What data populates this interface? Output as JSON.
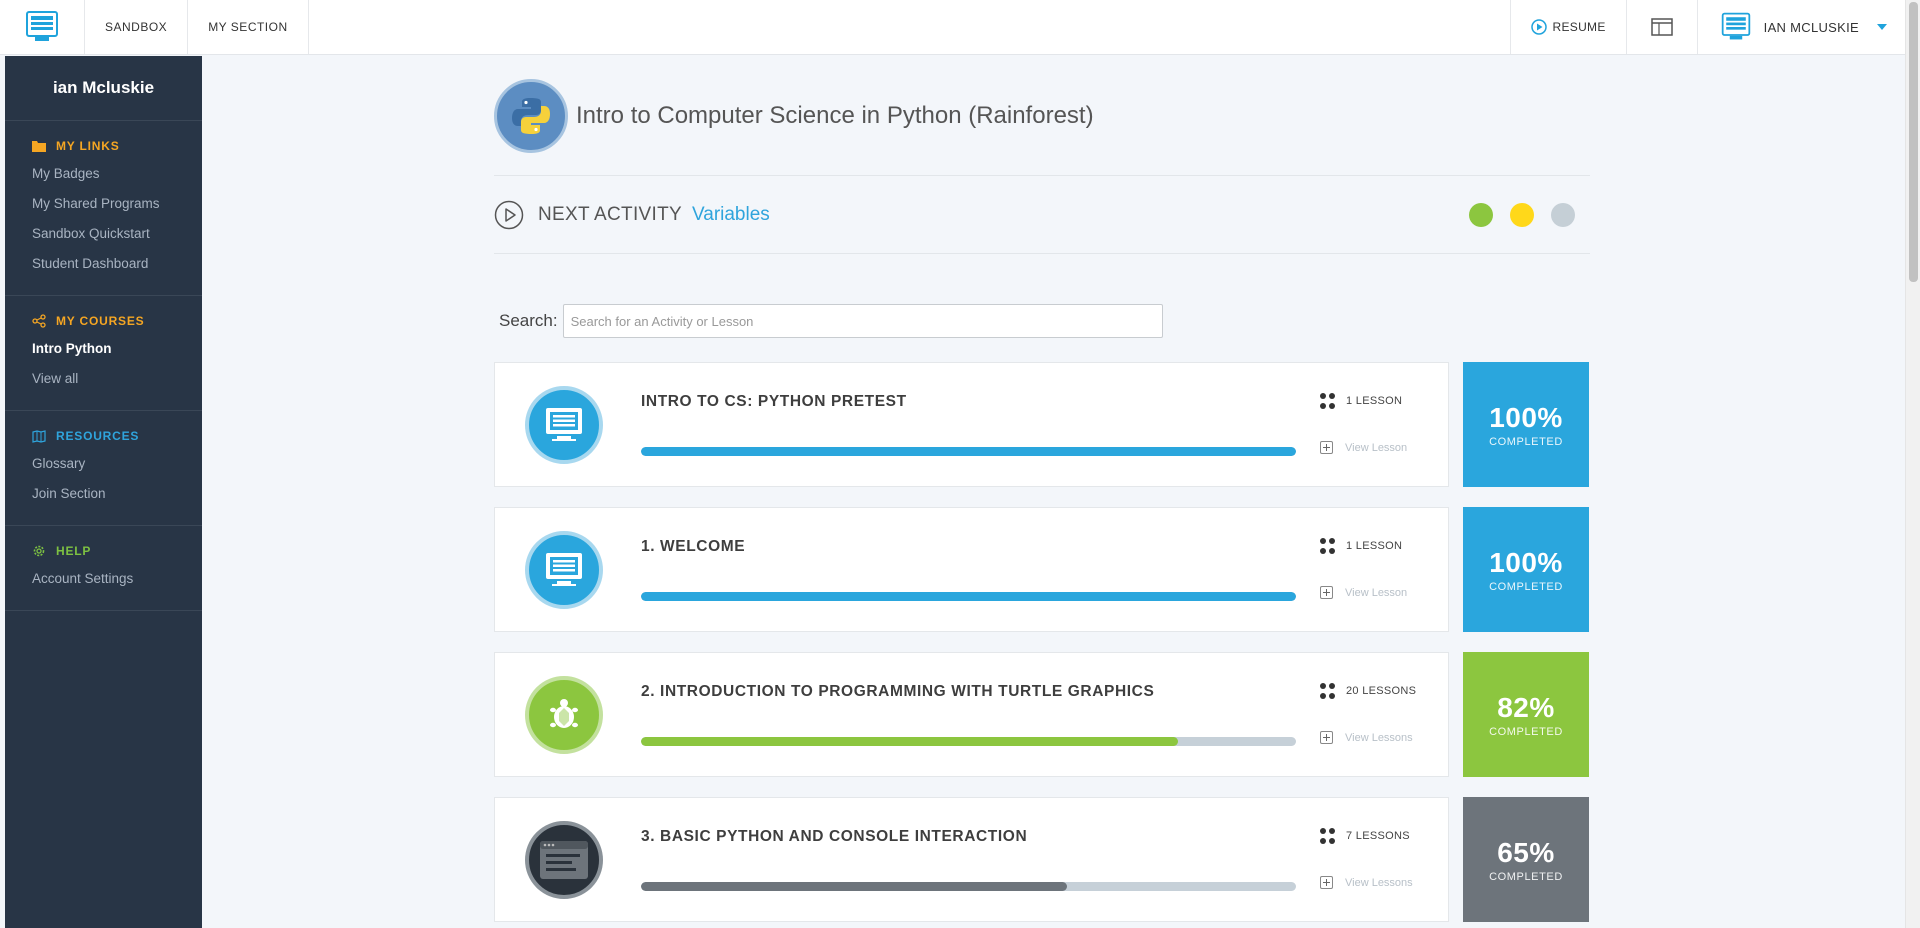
{
  "topbar": {
    "nav": [
      "SANDBOX",
      "MY SECTION"
    ],
    "resume_label": "RESUME",
    "user_label": "IAN MCLUSKIE"
  },
  "sidebar": {
    "user_name": "ian Mcluskie",
    "sections": [
      {
        "heading": "MY LINKS",
        "icon": "folder-icon",
        "links": [
          "My Badges",
          "My Shared Programs",
          "Sandbox Quickstart",
          "Student Dashboard"
        ]
      },
      {
        "heading": "MY COURSES",
        "icon": "share-icon",
        "links": [
          "Intro Python",
          "View all"
        ]
      },
      {
        "heading": "RESOURCES",
        "icon": "map-icon",
        "links": [
          "Glossary",
          "Join Section"
        ]
      },
      {
        "heading": "HELP",
        "icon": "gear-icon",
        "links": [
          "Account Settings"
        ]
      }
    ]
  },
  "course": {
    "title": "Intro to Computer Science in Python (Rainforest)",
    "next_activity_label": "NEXT ACTIVITY",
    "next_activity_value": "Variables",
    "status_dots": [
      "#8cc63f",
      "#ffd81a",
      "#c5cfd6"
    ]
  },
  "search": {
    "label": "Search:",
    "placeholder": "Search for an Activity or Lesson"
  },
  "units": [
    {
      "title": "INTRO TO CS: PYTHON PRETEST",
      "lessons": "1 LESSON",
      "view": "View Lesson",
      "percent": "100%",
      "progress": 100,
      "completed_label": "COMPLETED",
      "color": "#2aa6dd",
      "icon": "monitor-icon"
    },
    {
      "title": "1. WELCOME",
      "lessons": "1 LESSON",
      "view": "View Lesson",
      "percent": "100%",
      "progress": 100,
      "completed_label": "COMPLETED",
      "color": "#2aa6dd",
      "icon": "monitor-icon"
    },
    {
      "title": "2. INTRODUCTION TO PROGRAMMING WITH TURTLE GRAPHICS",
      "lessons": "20 LESSONS",
      "view": "View Lessons",
      "percent": "82%",
      "progress": 82,
      "completed_label": "COMPLETED",
      "color": "#8cc63f",
      "icon": "turtle-icon"
    },
    {
      "title": "3. BASIC PYTHON AND CONSOLE INTERACTION",
      "lessons": "7 LESSONS",
      "view": "View Lessons",
      "percent": "65%",
      "progress": 65,
      "completed_label": "COMPLETED",
      "color": "#6d747b",
      "icon": "console-icon"
    }
  ]
}
